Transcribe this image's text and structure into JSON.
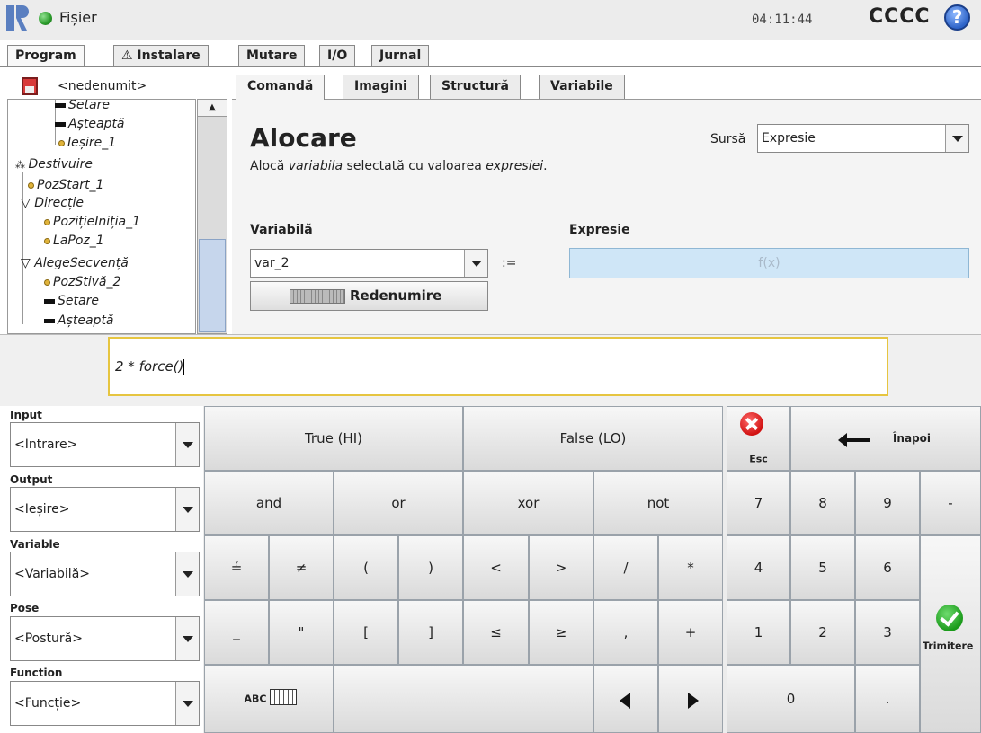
{
  "topbar": {
    "file_menu": "Fișier",
    "clock": "04:11:44",
    "robot_name": "CCCC",
    "help": "?"
  },
  "main_tabs": [
    "Program",
    "⚠ Instalare",
    "Mutare",
    "I/O",
    "Jurnal"
  ],
  "tree": {
    "header": "<nedenumit>",
    "items": [
      "Setare",
      "Așteaptă",
      "Ieșire_1",
      "Destivuire",
      "PozStart_1",
      "Direcție",
      "PozițieIniția_1",
      "LaPoz_1",
      "AlegeSecvență",
      "PozStivă_2",
      "Setare",
      "Așteaptă"
    ],
    "scroll_up": "▲"
  },
  "sub_tabs": [
    "Comandă",
    "Imagini",
    "Structură",
    "Variabile"
  ],
  "command": {
    "title": "Alocare",
    "subtitle_a": "Alocă ",
    "subtitle_b": "variabila",
    "subtitle_c": " selectată cu valoarea ",
    "subtitle_d": "expresiei",
    "subtitle_e": ".",
    "source_label": "Sursă",
    "source_value": "Expresie",
    "variable_label": "Variabilă",
    "expression_label": "Expresie",
    "variable_value": "var_2",
    "assign_op": ":=",
    "expression_placeholder": "f(x)",
    "rename_label": "Redenumire"
  },
  "editor": {
    "expression_text": "2 * force()"
  },
  "selectors": [
    {
      "label": "Input",
      "value": "<Intrare>"
    },
    {
      "label": "Output",
      "value": "<Ieșire>"
    },
    {
      "label": "Variable",
      "value": "<Variabilă>"
    },
    {
      "label": "Pose",
      "value": "<Postură>"
    },
    {
      "label": "Function",
      "value": "<Funcție>"
    }
  ],
  "keypad": {
    "true": "True (HI)",
    "false": "False (LO)",
    "esc": "Esc",
    "back": "Înapoi",
    "and": "and",
    "or": "or",
    "xor": "xor",
    "not": "not",
    "eq": "≟",
    "neq": "≠",
    "lparen": "(",
    "rparen": ")",
    "lt": "<",
    "gt": ">",
    "div": "/",
    "mul": "*",
    "underscore": "_",
    "quote": "\"",
    "lbracket": "[",
    "rbracket": "]",
    "le": "≤",
    "ge": "≥",
    "comma": ",",
    "plus": "+",
    "abc": "ABC",
    "n7": "7",
    "n8": "8",
    "n9": "9",
    "minus": "-",
    "n4": "4",
    "n5": "5",
    "n6": "6",
    "n1": "1",
    "n2": "2",
    "n3": "3",
    "n0": "0",
    "dot": ".",
    "submit": "Trimitere"
  }
}
